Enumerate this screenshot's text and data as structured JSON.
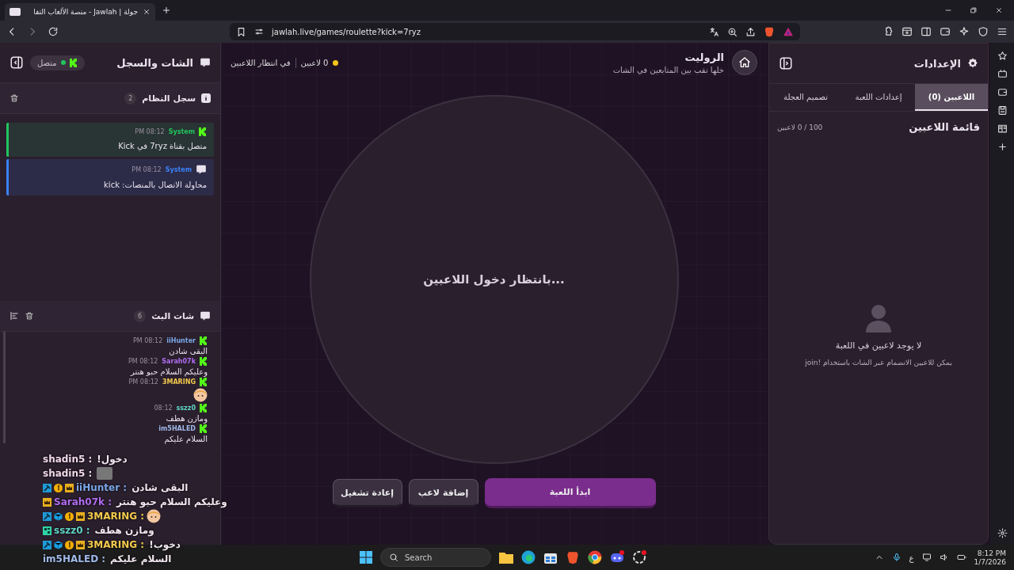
{
  "browser": {
    "tab_title": "جولة | Jawlah - منصة الألعاب التفا",
    "url": "jawlah.live/games/roulette?kick=7ryz"
  },
  "chat_panel": {
    "title": "الشات والسجل",
    "status": {
      "label": "متصل",
      "connected": true
    },
    "system_log": {
      "title": "سجل النظام",
      "count": "2",
      "entries": [
        {
          "author": "System",
          "time": "08:12 PM",
          "text": "متصل بقناة 7ryz في Kick",
          "color": "#22c55e",
          "kind": "kick"
        },
        {
          "author": "System",
          "time": "08:12 PM",
          "text": "محاولة الاتصال بالمنصات: kick",
          "color": "#3b82f6",
          "kind": "system"
        }
      ]
    },
    "stream_chat": {
      "title": "شات البث",
      "count": "6",
      "messages": [
        {
          "author": "iiHunter",
          "time": "08:12 PM",
          "kind": "text",
          "text": "البقى شادن",
          "color": "#7aa7e6"
        },
        {
          "author": "Sarah07k",
          "time": "08:12 PM",
          "kind": "text",
          "text": "وعليكم السلام حبو هنتر",
          "color": "#b06cf0"
        },
        {
          "author": "3MARING",
          "time": "08:12 PM",
          "kind": "emote",
          "color": "#f2c94c"
        },
        {
          "author": "sszz0",
          "time": "08:12",
          "kind": "text",
          "text": "ومازن هطف",
          "color": "#5fd3c4"
        },
        {
          "author": "im5HALED",
          "kind": "text",
          "text": "السلام عليكم",
          "color": "#9fb8e8"
        }
      ]
    }
  },
  "overlay": {
    "lines": [
      {
        "name": "shadin5 :",
        "text": "دخول!",
        "color": "#f0d8e8",
        "kind": "text"
      },
      {
        "name": "shadin5 :",
        "color": "#f0d8e8",
        "kind": "sticker"
      },
      {
        "name": "iiHunter :",
        "text": "البقى شادن",
        "badges": [
          {
            "kind": "pickaxe"
          },
          {
            "kind": "one"
          },
          {
            "kind": "crown"
          }
        ],
        "color": "#7aa7e6",
        "kind": "text"
      },
      {
        "name": "Sarah07k :",
        "text": "وعليكم السلام حبو هنتر",
        "badges": [
          {
            "kind": "crown"
          }
        ],
        "color": "#b06cf0",
        "kind": "text"
      },
      {
        "name": "3MARING :",
        "badges": [
          {
            "kind": "pickaxe"
          },
          {
            "kind": "cube"
          },
          {
            "kind": "one"
          },
          {
            "kind": "crown"
          }
        ],
        "color": "#f2c94c",
        "kind": "emote"
      },
      {
        "name": "sszz0 :",
        "text": "ومازن هطف",
        "badges": [
          {
            "kind": "grid"
          }
        ],
        "color": "#5fd3c4",
        "kind": "text"
      },
      {
        "name": "3MARING :",
        "text": "دخوب!",
        "badges": [
          {
            "kind": "pickaxe"
          },
          {
            "kind": "cube"
          },
          {
            "kind": "one"
          },
          {
            "kind": "crown"
          }
        ],
        "color": "#f2c94c",
        "kind": "text"
      },
      {
        "name": "im5HALED :",
        "text": "السلام عليكم",
        "color": "#9fb8e8",
        "kind": "text"
      }
    ]
  },
  "game": {
    "title": "الروليت",
    "subtitle": "خلها تقب بين المتابعين في الشات",
    "player_count": "0 لاعبين",
    "status": "في انتظار اللاعبين",
    "wheel_text": "بانتظار دخول اللاعبين...",
    "buttons": [
      {
        "label": "ابدأ اللعبة",
        "kind": "primary"
      },
      {
        "label": "إضافة لاعب",
        "kind": "secondary"
      },
      {
        "label": "إعادة تشغيل",
        "kind": "secondary"
      }
    ]
  },
  "settings": {
    "title": "الإعدادات",
    "tabs": [
      {
        "label": "اللاعبين (0)",
        "selected": true
      },
      {
        "label": "إعدادات اللعبة",
        "selected": false
      },
      {
        "label": "تصميم العجلة",
        "selected": false
      }
    ],
    "list_title": "قائمة اللاعبين",
    "list_count": "100 / 0 لاعبين",
    "empty_title": "لا يوجد لاعبين في اللعبة",
    "empty_hint": "يمكن للاعبين الانضمام عبر الشات باستخدام !join"
  },
  "taskbar": {
    "search_placeholder": "Search",
    "language": "ع",
    "time": "8:12 PM",
    "date": "1/7/2026"
  }
}
